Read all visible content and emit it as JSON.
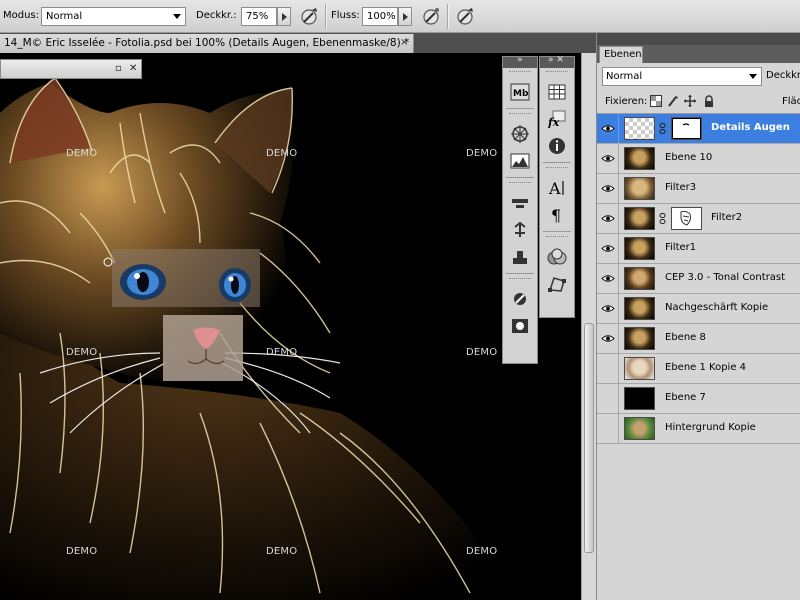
{
  "options_bar": {
    "mode_label": "Modus:",
    "mode_value": "Normal",
    "opacity_label": "Deckkr.:",
    "opacity_value": "75%",
    "flow_label": "Fluss:",
    "flow_value": "100%"
  },
  "document": {
    "tab_title": "14_M© Eric Isselée - Fotolia.psd bei 100% (Details Augen, Ebenenmaske/8) *",
    "tab_close": "×",
    "watermark": "DEMO"
  },
  "layers_panel": {
    "tab_label": "Ebenen",
    "blend_mode": "Normal",
    "opacity_label": "Deckkra",
    "lock_label": "Fixieren:",
    "fill_label": "Fläc",
    "layers": [
      {
        "name": "Details Augen",
        "visible": true,
        "selected": true,
        "has_mask": true
      },
      {
        "name": "Ebene 10",
        "visible": true
      },
      {
        "name": "Filter3",
        "visible": true
      },
      {
        "name": "Filter2",
        "visible": true,
        "has_mask": true
      },
      {
        "name": "Filter1",
        "visible": true
      },
      {
        "name": "CEP 3.0 - Tonal Contrast",
        "visible": true
      },
      {
        "name": "Nachgeschärft Kopie",
        "visible": true
      },
      {
        "name": "Ebene 8",
        "visible": true
      },
      {
        "name": "Ebene 1 Kopie 4",
        "visible": false
      },
      {
        "name": "Ebene 7",
        "visible": false
      },
      {
        "name": "Hintergrund Kopie",
        "visible": false
      }
    ]
  },
  "colors": {
    "selection": "#3d7fe0",
    "panel_bg": "#d5d5d5",
    "canvas_bg": "#000000"
  }
}
